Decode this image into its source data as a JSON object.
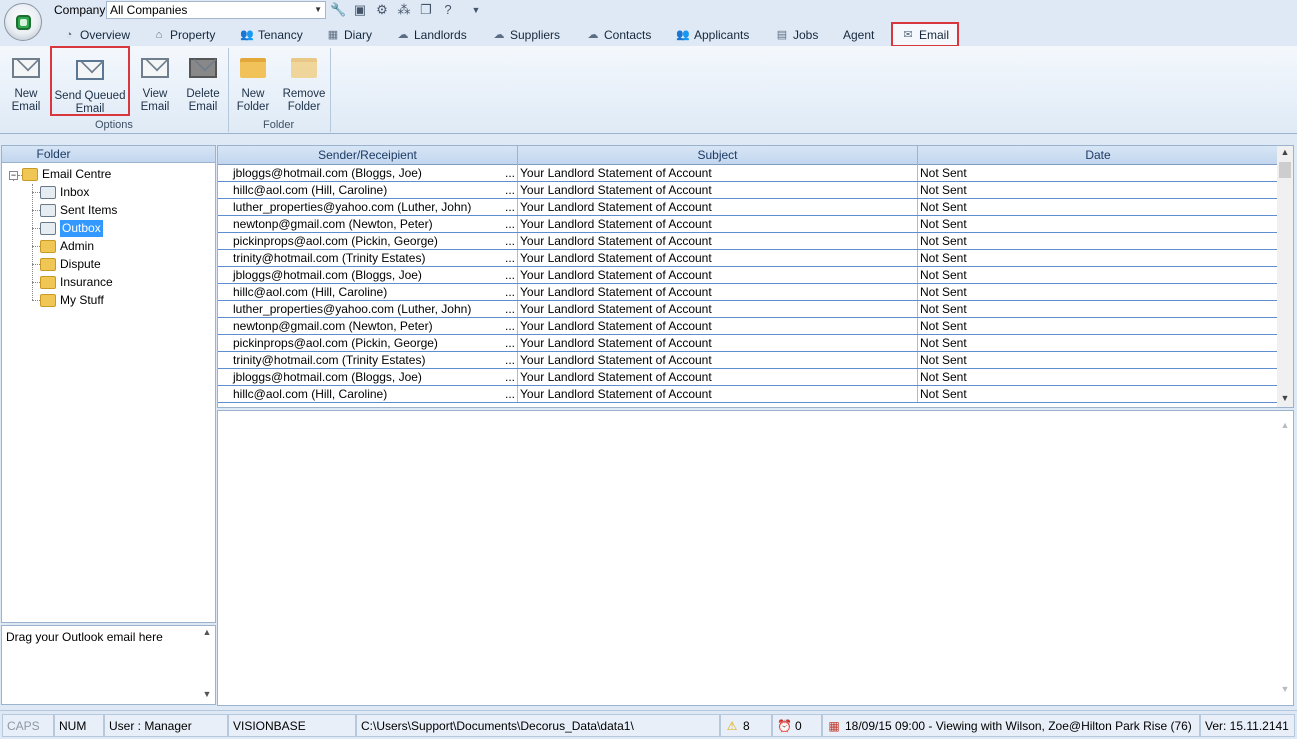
{
  "company": {
    "label": "Company",
    "value": "All Companies"
  },
  "quick_access": [
    "wrench-icon",
    "camera-icon",
    "gear-icon",
    "network-icon",
    "copy-icon",
    "help-icon",
    "dropdown-icon"
  ],
  "tabs": [
    {
      "label": "Overview",
      "icon": "overview-icon"
    },
    {
      "label": "Property",
      "icon": "house-icon"
    },
    {
      "label": "Tenancy",
      "icon": "people-icon"
    },
    {
      "label": "Diary",
      "icon": "calendar-icon"
    },
    {
      "label": "Landlords",
      "icon": "landlord-icon"
    },
    {
      "label": "Suppliers",
      "icon": "supplier-icon"
    },
    {
      "label": "Contacts",
      "icon": "contacts-icon"
    },
    {
      "label": "Applicants",
      "icon": "applicants-icon"
    },
    {
      "label": "Jobs",
      "icon": "jobs-icon"
    },
    {
      "label": "Agent",
      "icon": ""
    },
    {
      "label": "Email",
      "icon": "email-icon"
    }
  ],
  "ribbon": {
    "new_email": "New\nEmail",
    "send_queued": "Send Queued\nEmail",
    "view_email": "View\nEmail",
    "delete_email": "Delete\nEmail",
    "options_group": "Options",
    "new_folder": "New\nFolder",
    "remove_folder": "Remove\nFolder",
    "folder_group": "Folder"
  },
  "folders": {
    "header": "Folder",
    "root": "Email Centre",
    "items": [
      "Inbox",
      "Sent Items",
      "Outbox",
      "Admin",
      "Dispute",
      "Insurance",
      "My Stuff"
    ],
    "selected": "Outbox"
  },
  "drag_text": "Drag your Outlook email here",
  "grid": {
    "columns": [
      "Sender/Receipient",
      "Subject",
      "Date"
    ],
    "rows": [
      [
        "jbloggs@hotmail.com (Bloggs, Joe)",
        "Your Landlord Statement of Account",
        "Not Sent"
      ],
      [
        "hillc@aol.com (Hill, Caroline)",
        "Your Landlord Statement of Account",
        "Not Sent"
      ],
      [
        "luther_properties@yahoo.com (Luther, John)",
        "Your Landlord Statement of Account",
        "Not Sent"
      ],
      [
        "newtonp@gmail.com (Newton, Peter)",
        "Your Landlord Statement of Account",
        "Not Sent"
      ],
      [
        "pickinprops@aol.com (Pickin, George)",
        "Your Landlord Statement of Account",
        "Not Sent"
      ],
      [
        "trinity@hotmail.com (Trinity Estates)",
        "Your Landlord Statement of Account",
        "Not Sent"
      ],
      [
        "jbloggs@hotmail.com (Bloggs, Joe)",
        "Your Landlord Statement of Account",
        "Not Sent"
      ],
      [
        "hillc@aol.com (Hill, Caroline)",
        "Your Landlord Statement of Account",
        "Not Sent"
      ],
      [
        "luther_properties@yahoo.com (Luther, John)",
        "Your Landlord Statement of Account",
        "Not Sent"
      ],
      [
        "newtonp@gmail.com (Newton, Peter)",
        "Your Landlord Statement of Account",
        "Not Sent"
      ],
      [
        "pickinprops@aol.com (Pickin, George)",
        "Your Landlord Statement of Account",
        "Not Sent"
      ],
      [
        "trinity@hotmail.com (Trinity Estates)",
        "Your Landlord Statement of Account",
        "Not Sent"
      ],
      [
        "jbloggs@hotmail.com (Bloggs, Joe)",
        "Your Landlord Statement of Account",
        "Not Sent"
      ],
      [
        "hillc@aol.com (Hill, Caroline)",
        "Your Landlord Statement of Account",
        "Not Sent"
      ]
    ],
    "ellipsis": "..."
  },
  "status": {
    "caps": "CAPS",
    "num": "NUM",
    "user": "User : Manager",
    "db": "VISIONBASE",
    "path": "C:\\Users\\Support\\Documents\\Decorus_Data\\data1\\",
    "warnings": "8",
    "alarms": "0",
    "diary": "18/09/15 09:00 - Viewing with Wilson, Zoe@Hilton Park Rise (76)",
    "version": "Ver: 15.11.2141"
  },
  "colors": {
    "highlight": "#d9373e",
    "selection": "#3399ff"
  }
}
